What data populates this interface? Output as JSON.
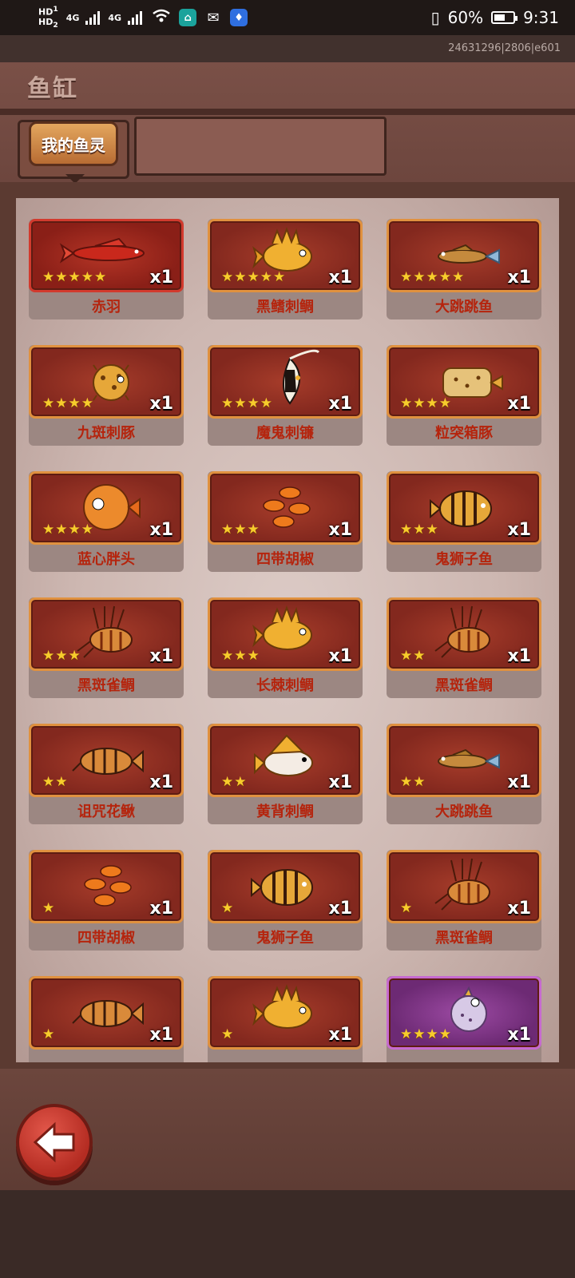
{
  "status_bar": {
    "hd1": "HD",
    "hd1_sub": "1",
    "hd2": "HD",
    "hd2_sub": "2",
    "sig1": "4G",
    "sig2": "4G",
    "battery_percent": "60%",
    "battery_level": 0.6,
    "time": "9:31"
  },
  "id_strip": "24631296|2806|e601",
  "header": {
    "title": "鱼缸",
    "tab_label": "我的鱼灵"
  },
  "fish_cards": [
    {
      "name": "赤羽",
      "stars": "★★★★★",
      "count": "x1",
      "style": "red",
      "fish": "long-red"
    },
    {
      "name": "黑鳍刺鲷",
      "stars": "★★★★★",
      "count": "x1",
      "style": "orange",
      "fish": "spiky-yellow"
    },
    {
      "name": "大跳跳鱼",
      "stars": "★★★★★",
      "count": "x1",
      "style": "orange",
      "fish": "goby"
    },
    {
      "name": "九斑刺豚",
      "stars": "★★★★",
      "count": "x1",
      "style": "orange",
      "fish": "puffer"
    },
    {
      "name": "魔鬼刺镰",
      "stars": "★★★★",
      "count": "x1",
      "style": "orange",
      "fish": "moorish"
    },
    {
      "name": "粒突箱豚",
      "stars": "★★★★",
      "count": "x1",
      "style": "orange",
      "fish": "boxfish"
    },
    {
      "name": "蓝心胖头",
      "stars": "★★★★",
      "count": "x1",
      "style": "orange",
      "fish": "round-orange"
    },
    {
      "name": "四带胡椒",
      "stars": "★★★",
      "count": "x1",
      "style": "orange",
      "fish": "school"
    },
    {
      "name": "鬼狮子鱼",
      "stars": "★★★",
      "count": "x1",
      "style": "orange",
      "fish": "striped"
    },
    {
      "name": "黑斑雀鲷",
      "stars": "★★★",
      "count": "x1",
      "style": "orange",
      "fish": "lionfish"
    },
    {
      "name": "长棘刺鲷",
      "stars": "★★★",
      "count": "x1",
      "style": "orange",
      "fish": "spiky-yellow"
    },
    {
      "name": "黑斑雀鲷",
      "stars": "★★",
      "count": "x1",
      "style": "orange",
      "fish": "lionfish"
    },
    {
      "name": "诅咒花鳅",
      "stars": "★★",
      "count": "x1",
      "style": "orange",
      "fish": "catfish"
    },
    {
      "name": "黄背刺鲷",
      "stars": "★★",
      "count": "x1",
      "style": "orange",
      "fish": "white-yellow"
    },
    {
      "name": "大跳跳鱼",
      "stars": "★★",
      "count": "x1",
      "style": "orange",
      "fish": "goby"
    },
    {
      "name": "四带胡椒",
      "stars": "★",
      "count": "x1",
      "style": "orange",
      "fish": "school"
    },
    {
      "name": "鬼狮子鱼",
      "stars": "★",
      "count": "x1",
      "style": "orange",
      "fish": "striped"
    },
    {
      "name": "黑斑雀鲷",
      "stars": "★",
      "count": "x1",
      "style": "orange",
      "fish": "lionfish"
    },
    {
      "name": "",
      "stars": "★",
      "count": "x1",
      "style": "orange",
      "fish": "catfish"
    },
    {
      "name": "",
      "stars": "★",
      "count": "x1",
      "style": "orange",
      "fish": "spiky-yellow"
    },
    {
      "name": "",
      "stars": "★★★★",
      "count": "x1",
      "style": "purple",
      "fish": "puffer-purple"
    }
  ],
  "colors": {
    "accent_orange": "#e0913f",
    "name_red": "#b5240d",
    "star_gold": "#f7cc2c",
    "back_button": "#c8362a"
  },
  "icons": {
    "back": "arrow-left-icon"
  }
}
